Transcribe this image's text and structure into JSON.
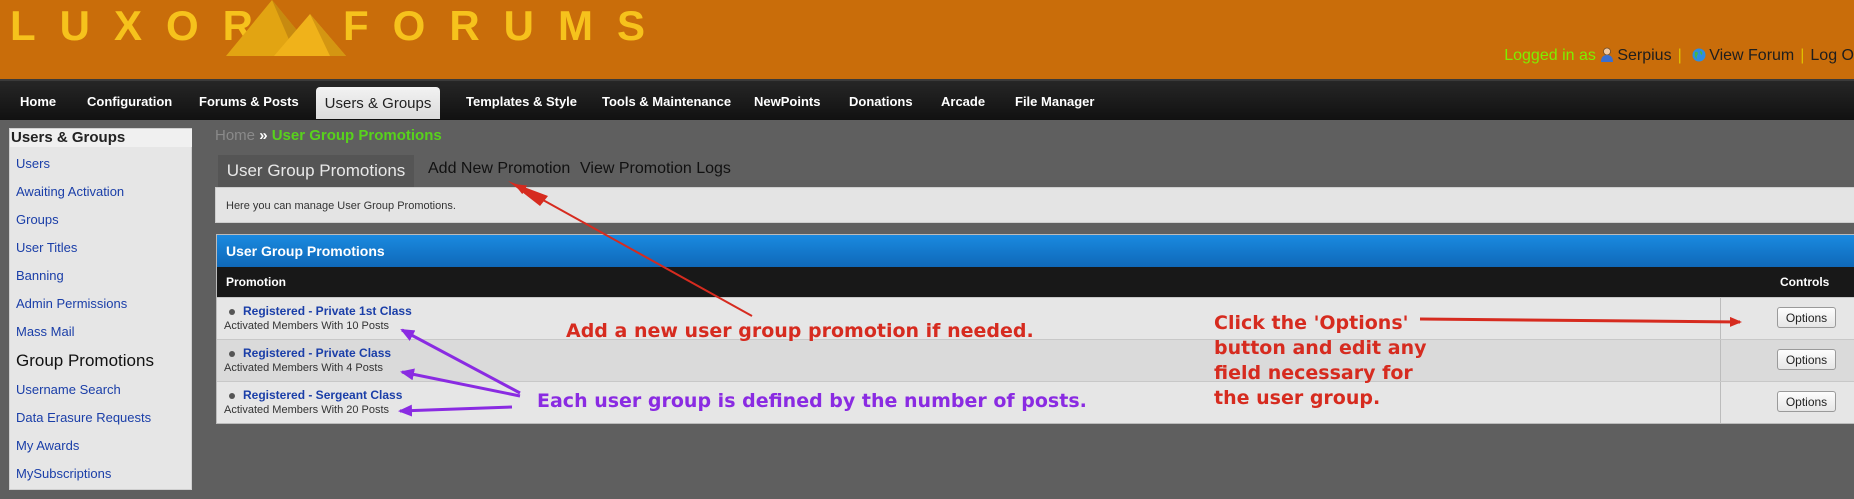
{
  "header": {
    "logo_left": "LUXOR",
    "logo_right": "FORUMS",
    "logged_in_label": "Logged in as",
    "username": "Serpius",
    "view_forum": "View Forum",
    "log_out": "Log O",
    "separator": "|"
  },
  "nav": {
    "items": [
      "Home",
      "Configuration",
      "Forums & Posts",
      "Users & Groups",
      "Templates & Style",
      "Tools & Maintenance",
      "NewPoints",
      "Donations",
      "Arcade",
      "File Manager"
    ],
    "active": "Users & Groups"
  },
  "sidebar": {
    "title": "Users & Groups",
    "items": [
      "Users",
      "Awaiting Activation",
      "Groups",
      "User Titles",
      "Banning",
      "Admin Permissions",
      "Mass Mail",
      "Group Promotions",
      "Username Search",
      "Data Erasure Requests",
      "My Awards",
      "MySubscriptions"
    ],
    "active": "Group Promotions"
  },
  "breadcrumb": {
    "home": "Home",
    "separator": "»",
    "current": "User Group Promotions"
  },
  "tabs": [
    "User Group Promotions",
    "Add New Promotion",
    "View Promotion Logs"
  ],
  "description": "Here you can manage User Group Promotions.",
  "table": {
    "title": "User Group Promotions",
    "columns": [
      "Promotion",
      "Controls"
    ],
    "rows": [
      {
        "title": "Registered - Private 1st Class",
        "subtitle": "Activated Members With 10 Posts",
        "button": "Options"
      },
      {
        "title": "Registered - Private Class",
        "subtitle": "Activated Members With 4 Posts",
        "button": "Options"
      },
      {
        "title": "Registered - Sergeant Class",
        "subtitle": "Activated Members With 20 Posts",
        "button": "Options"
      }
    ]
  },
  "annotations": {
    "add_promotion": "Add a new user group promotion if needed.",
    "options_lines": [
      "Click the 'Options'",
      "button and edit any",
      "field necessary for",
      "the user group."
    ],
    "posts_note": "Each user group is defined by the number of posts."
  },
  "colors": {
    "header_bg": "#c96d0a",
    "logo": "#f6c21c",
    "table_header": "#1478cc",
    "annotation_red": "#d62b1f",
    "annotation_purple": "#8a2be2"
  }
}
